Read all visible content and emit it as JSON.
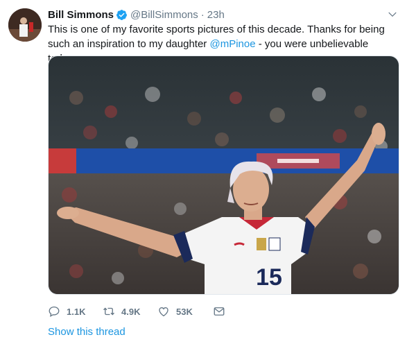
{
  "tweet": {
    "author": {
      "name": "Bill Simmons",
      "handle": "@BillSimmons",
      "verified": true
    },
    "separator": "·",
    "timestamp": "23h",
    "text_before": "This is one of my favorite sports pictures of this decade. Thanks for being such an inspiration to my daughter ",
    "mention": "@mPinoe",
    "text_after": " - you were unbelievable today.",
    "media": {
      "jersey_number": "15"
    },
    "actions": {
      "reply_count": "1.1K",
      "retweet_count": "4.9K",
      "like_count": "53K"
    },
    "show_thread_label": "Show this thread"
  },
  "colors": {
    "link": "#1b95e0",
    "muted": "#657786",
    "verified": "#1da1f2"
  },
  "icons": [
    "verified-badge-icon",
    "chevron-down-icon",
    "reply-icon",
    "retweet-icon",
    "like-icon",
    "direct-message-icon"
  ]
}
